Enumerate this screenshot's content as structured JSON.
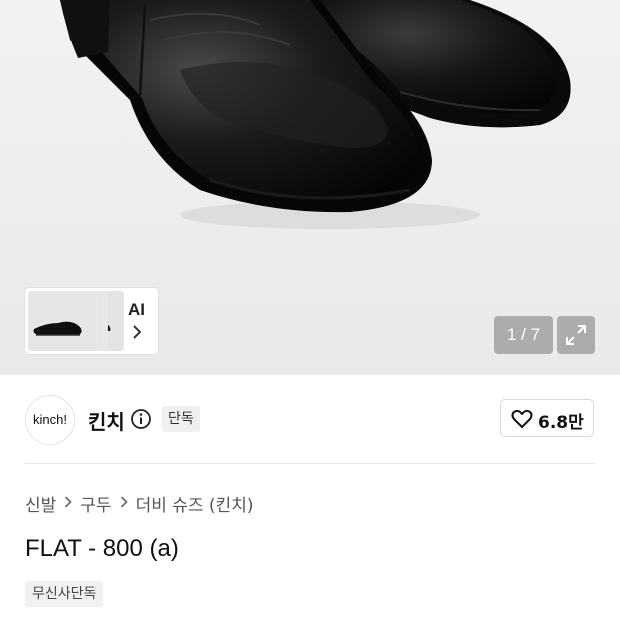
{
  "gallery": {
    "ai_label": "AI",
    "pager_text": "1 / 7",
    "current_index": 1,
    "total": 7
  },
  "brand": {
    "logo_text": "kinch!",
    "name": "킨치",
    "exclusive_badge": "단독",
    "likes": "6.8만"
  },
  "breadcrumb": [
    "신발",
    "구두",
    "더비 슈즈 (킨치)"
  ],
  "product": {
    "title": "FLAT - 800 (a)",
    "tag": "무신사단독"
  },
  "colors": {
    "hero_bg": "#ececec",
    "text_primary": "#111111",
    "text_secondary": "#555555",
    "badge_bg": "#f0f0f0"
  },
  "icons": [
    "chevron-right-icon",
    "expand-icon",
    "info-icon",
    "heart-icon",
    "breadcrumb-chevron-icon"
  ]
}
